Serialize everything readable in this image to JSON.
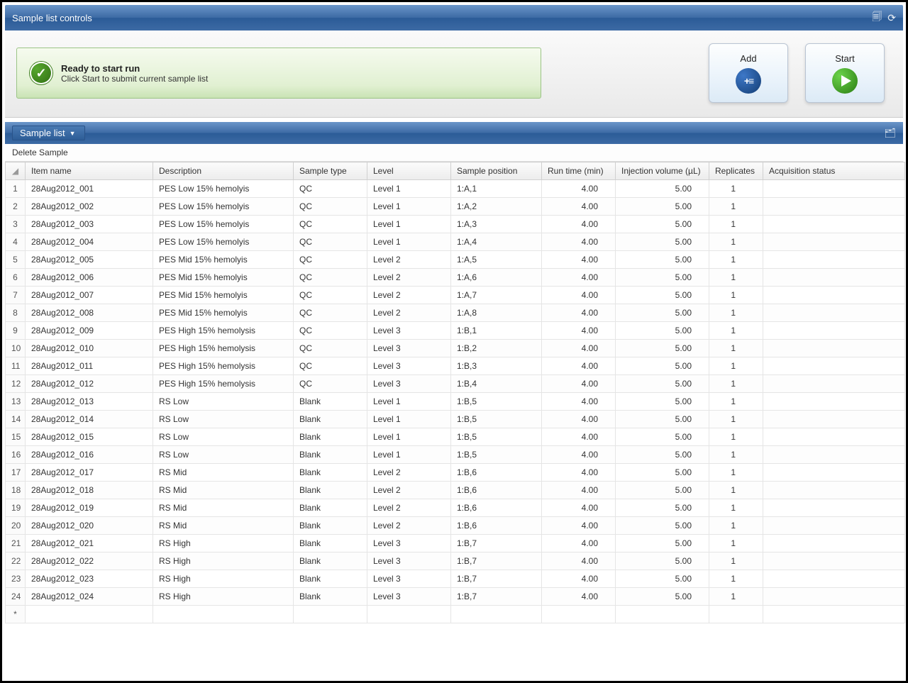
{
  "titleBar": {
    "title": "Sample list controls"
  },
  "status": {
    "title": "Ready to start run",
    "subtitle": "Click Start to submit current sample list"
  },
  "buttons": {
    "add": "Add",
    "start": "Start"
  },
  "sampleListDropdown": "Sample list",
  "contextItem": "Delete Sample",
  "columns": {
    "itemName": "Item name",
    "description": "Description",
    "sampleType": "Sample type",
    "level": "Level",
    "samplePosition": "Sample position",
    "runTime": "Run time (min)",
    "injVol": "Injection volume (µL)",
    "replicates": "Replicates",
    "acq": "Acquisition status"
  },
  "rows": [
    {
      "n": "1",
      "item": "28Aug2012_001",
      "desc": "PES Low 15% hemolyis",
      "type": "QC",
      "level": "Level 1",
      "pos": "1:A,1",
      "run": "4.00",
      "inj": "5.00",
      "rep": "1",
      "acq": ""
    },
    {
      "n": "2",
      "item": "28Aug2012_002",
      "desc": "PES Low 15% hemolyis",
      "type": "QC",
      "level": "Level 1",
      "pos": "1:A,2",
      "run": "4.00",
      "inj": "5.00",
      "rep": "1",
      "acq": ""
    },
    {
      "n": "3",
      "item": "28Aug2012_003",
      "desc": "PES Low 15% hemolyis",
      "type": "QC",
      "level": "Level 1",
      "pos": "1:A,3",
      "run": "4.00",
      "inj": "5.00",
      "rep": "1",
      "acq": ""
    },
    {
      "n": "4",
      "item": "28Aug2012_004",
      "desc": "PES Low 15% hemolyis",
      "type": "QC",
      "level": "Level 1",
      "pos": "1:A,4",
      "run": "4.00",
      "inj": "5.00",
      "rep": "1",
      "acq": ""
    },
    {
      "n": "5",
      "item": "28Aug2012_005",
      "desc": "PES Mid 15% hemolyis",
      "type": "QC",
      "level": "Level 2",
      "pos": "1:A,5",
      "run": "4.00",
      "inj": "5.00",
      "rep": "1",
      "acq": ""
    },
    {
      "n": "6",
      "item": "28Aug2012_006",
      "desc": "PES Mid 15% hemolyis",
      "type": "QC",
      "level": "Level 2",
      "pos": "1:A,6",
      "run": "4.00",
      "inj": "5.00",
      "rep": "1",
      "acq": ""
    },
    {
      "n": "7",
      "item": "28Aug2012_007",
      "desc": "PES Mid 15% hemolyis",
      "type": "QC",
      "level": "Level 2",
      "pos": "1:A,7",
      "run": "4.00",
      "inj": "5.00",
      "rep": "1",
      "acq": ""
    },
    {
      "n": "8",
      "item": "28Aug2012_008",
      "desc": "PES Mid 15% hemolyis",
      "type": "QC",
      "level": "Level 2",
      "pos": "1:A,8",
      "run": "4.00",
      "inj": "5.00",
      "rep": "1",
      "acq": ""
    },
    {
      "n": "9",
      "item": "28Aug2012_009",
      "desc": "PES High 15% hemolysis",
      "type": "QC",
      "level": "Level 3",
      "pos": "1:B,1",
      "run": "4.00",
      "inj": "5.00",
      "rep": "1",
      "acq": ""
    },
    {
      "n": "10",
      "item": "28Aug2012_010",
      "desc": "PES High 15% hemolysis",
      "type": "QC",
      "level": "Level 3",
      "pos": "1:B,2",
      "run": "4.00",
      "inj": "5.00",
      "rep": "1",
      "acq": ""
    },
    {
      "n": "11",
      "item": "28Aug2012_011",
      "desc": "PES High 15% hemolysis",
      "type": "QC",
      "level": "Level 3",
      "pos": "1:B,3",
      "run": "4.00",
      "inj": "5.00",
      "rep": "1",
      "acq": ""
    },
    {
      "n": "12",
      "item": "28Aug2012_012",
      "desc": "PES High 15% hemolysis",
      "type": "QC",
      "level": "Level 3",
      "pos": "1:B,4",
      "run": "4.00",
      "inj": "5.00",
      "rep": "1",
      "acq": ""
    },
    {
      "n": "13",
      "item": "28Aug2012_013",
      "desc": "RS Low",
      "type": "Blank",
      "level": "Level 1",
      "pos": "1:B,5",
      "run": "4.00",
      "inj": "5.00",
      "rep": "1",
      "acq": ""
    },
    {
      "n": "14",
      "item": "28Aug2012_014",
      "desc": "RS Low",
      "type": "Blank",
      "level": "Level 1",
      "pos": "1:B,5",
      "run": "4.00",
      "inj": "5.00",
      "rep": "1",
      "acq": ""
    },
    {
      "n": "15",
      "item": "28Aug2012_015",
      "desc": "RS Low",
      "type": "Blank",
      "level": "Level 1",
      "pos": "1:B,5",
      "run": "4.00",
      "inj": "5.00",
      "rep": "1",
      "acq": ""
    },
    {
      "n": "16",
      "item": "28Aug2012_016",
      "desc": "RS Low",
      "type": "Blank",
      "level": "Level 1",
      "pos": "1:B,5",
      "run": "4.00",
      "inj": "5.00",
      "rep": "1",
      "acq": ""
    },
    {
      "n": "17",
      "item": "28Aug2012_017",
      "desc": "RS Mid",
      "type": "Blank",
      "level": "Level 2",
      "pos": "1:B,6",
      "run": "4.00",
      "inj": "5.00",
      "rep": "1",
      "acq": ""
    },
    {
      "n": "18",
      "item": "28Aug2012_018",
      "desc": "RS Mid",
      "type": "Blank",
      "level": "Level 2",
      "pos": "1:B,6",
      "run": "4.00",
      "inj": "5.00",
      "rep": "1",
      "acq": ""
    },
    {
      "n": "19",
      "item": "28Aug2012_019",
      "desc": "RS Mid",
      "type": "Blank",
      "level": "Level 2",
      "pos": "1:B,6",
      "run": "4.00",
      "inj": "5.00",
      "rep": "1",
      "acq": ""
    },
    {
      "n": "20",
      "item": "28Aug2012_020",
      "desc": "RS Mid",
      "type": "Blank",
      "level": "Level 2",
      "pos": "1:B,6",
      "run": "4.00",
      "inj": "5.00",
      "rep": "1",
      "acq": ""
    },
    {
      "n": "21",
      "item": "28Aug2012_021",
      "desc": "RS High",
      "type": "Blank",
      "level": "Level 3",
      "pos": "1:B,7",
      "run": "4.00",
      "inj": "5.00",
      "rep": "1",
      "acq": ""
    },
    {
      "n": "22",
      "item": "28Aug2012_022",
      "desc": "RS High",
      "type": "Blank",
      "level": "Level 3",
      "pos": "1:B,7",
      "run": "4.00",
      "inj": "5.00",
      "rep": "1",
      "acq": ""
    },
    {
      "n": "23",
      "item": "28Aug2012_023",
      "desc": "RS High",
      "type": "Blank",
      "level": "Level 3",
      "pos": "1:B,7",
      "run": "4.00",
      "inj": "5.00",
      "rep": "1",
      "acq": ""
    },
    {
      "n": "24",
      "item": "28Aug2012_024",
      "desc": "RS High",
      "type": "Blank",
      "level": "Level 3",
      "pos": "1:B,7",
      "run": "4.00",
      "inj": "5.00",
      "rep": "1",
      "acq": ""
    }
  ],
  "newRowMarker": "*"
}
